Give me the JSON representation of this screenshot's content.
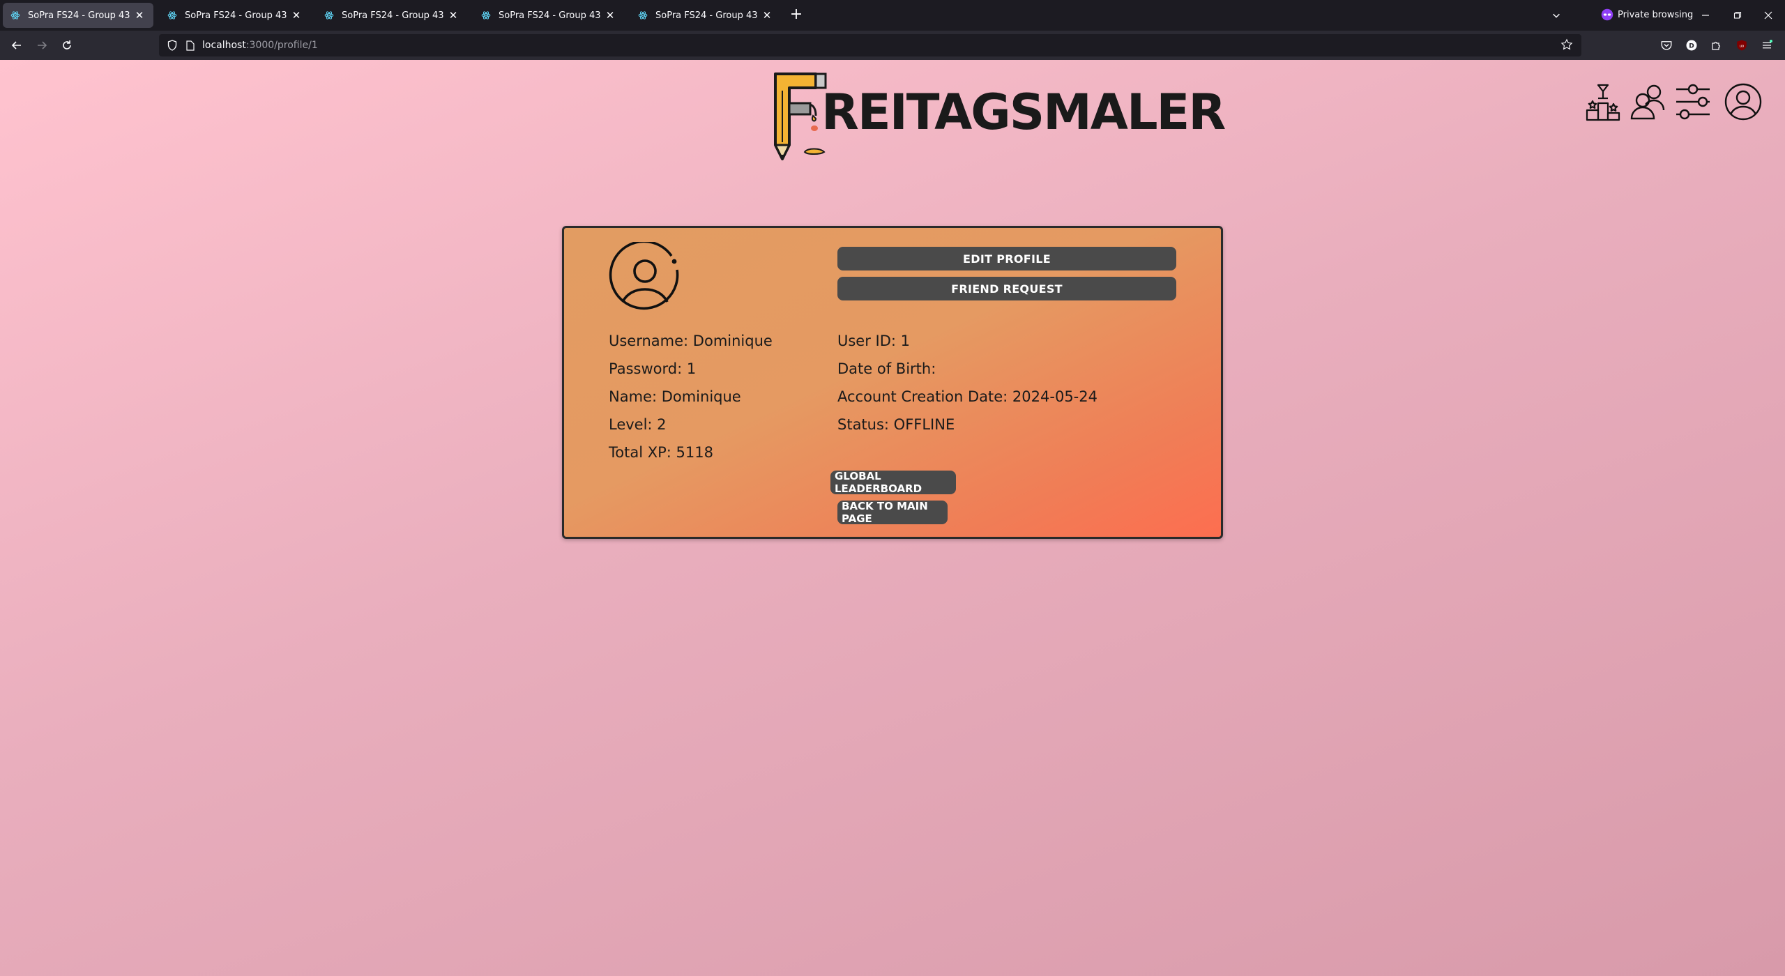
{
  "browser": {
    "tabs": [
      {
        "title": "SoPra FS24 - Group 43",
        "active": true
      },
      {
        "title": "SoPra FS24 - Group 43",
        "active": false
      },
      {
        "title": "SoPra FS24 - Group 43",
        "active": false
      },
      {
        "title": "SoPra FS24 - Group 43",
        "active": false
      },
      {
        "title": "SoPra FS24 - Group 43",
        "active": false
      }
    ],
    "new_tab": "+",
    "private_label": "Private browsing",
    "url_host": "localhost",
    "url_path": ":3000/profile/1"
  },
  "header": {
    "logo_text": "REITAGSMALER"
  },
  "profile": {
    "edit_button": "EDIT PROFILE",
    "friend_button": "FRIEND REQUEST",
    "left_fields": [
      "Username: Dominique",
      "Password: 1",
      "Name: Dominique",
      "Level: 2",
      "Total XP: 5118"
    ],
    "right_fields": [
      "User ID: 1",
      "Date of Birth:",
      "Account Creation Date: 2024-05-24",
      "Status: OFFLINE"
    ],
    "leaderboard_button": "GLOBAL LEADERBOARD",
    "main_page_button": "BACK TO MAIN PAGE"
  },
  "colors": {
    "card_border": "#2a2a2a",
    "button_bg": "#4a4a4a",
    "page_gradient_start": "#ffc3cf",
    "page_gradient_end": "#d89aaa"
  }
}
